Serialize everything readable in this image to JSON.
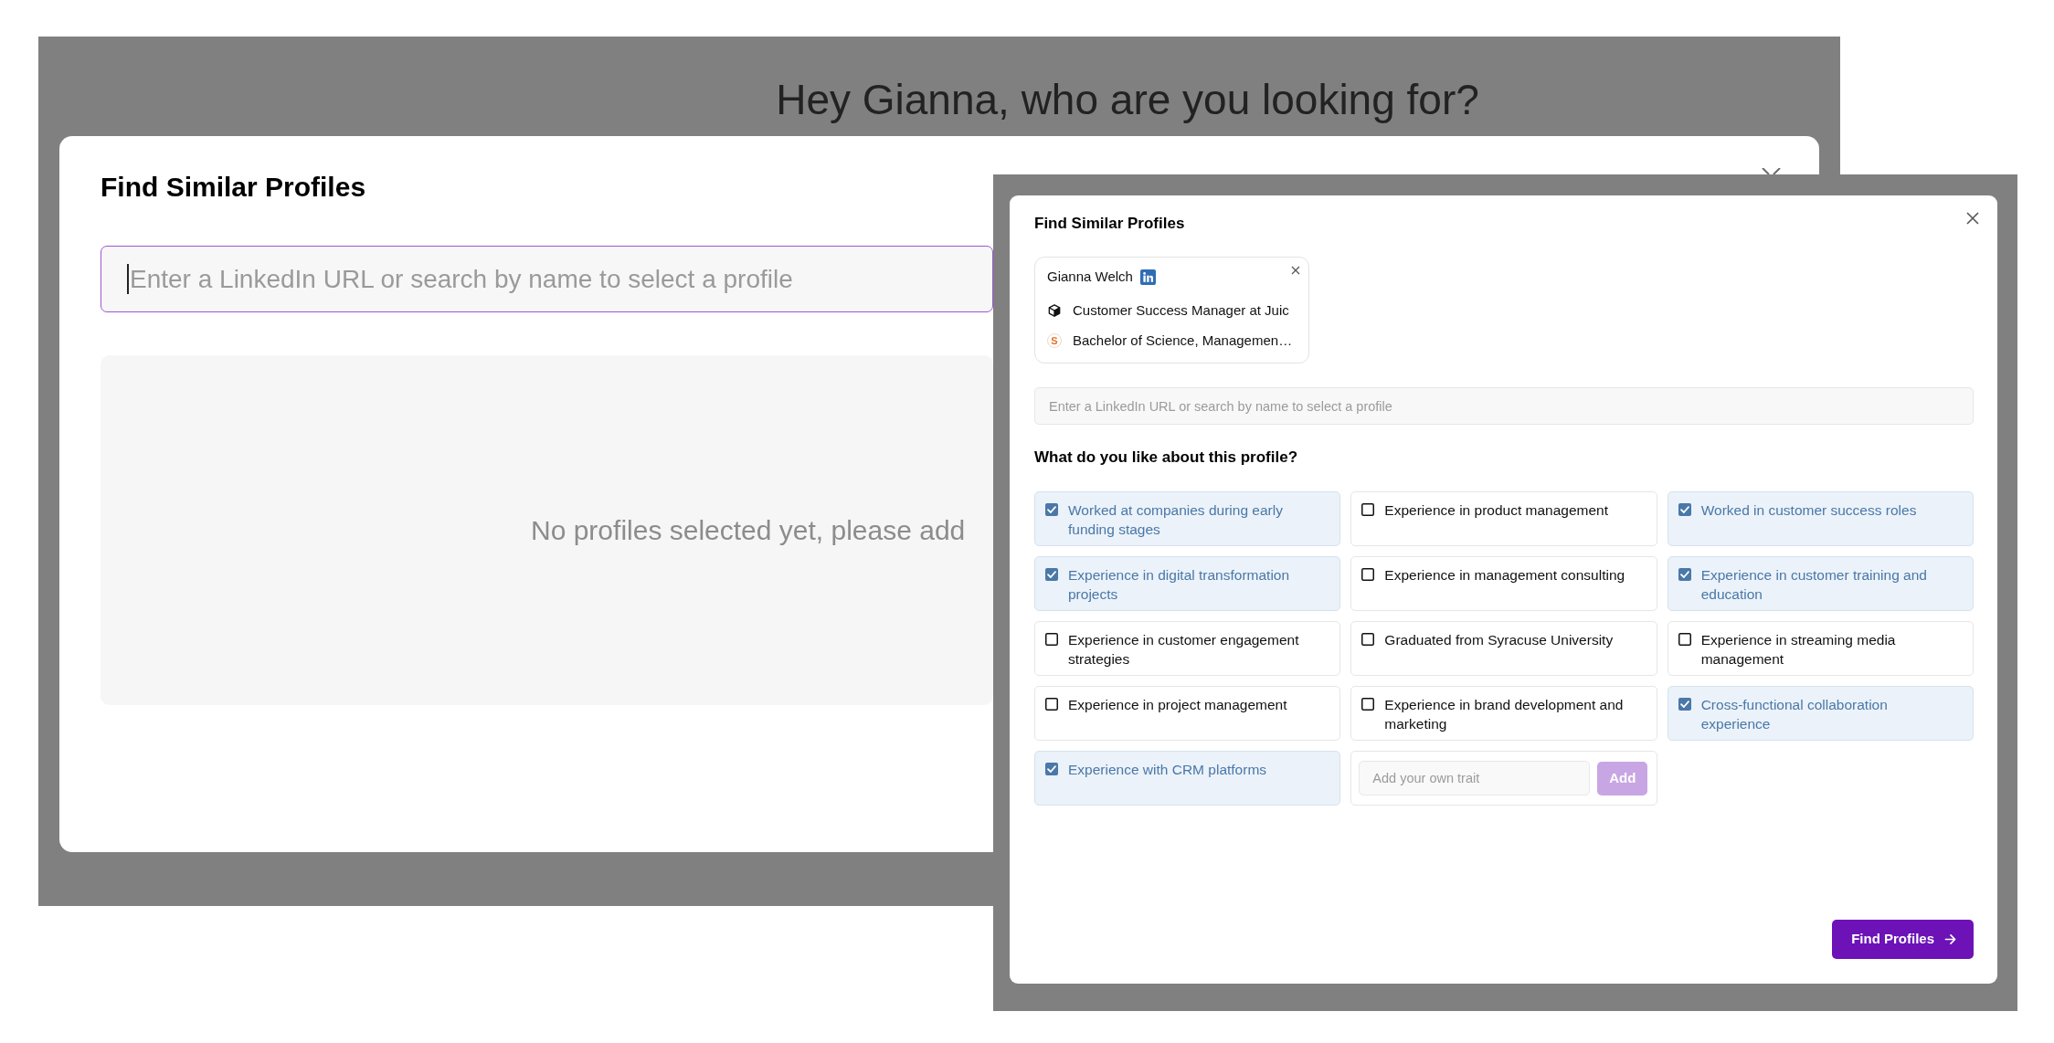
{
  "background_window": {
    "greeting": "Hey Gianna, who are you looking for?",
    "modal": {
      "title": "Find Similar Profiles",
      "search": {
        "placeholder": "Enter a LinkedIn URL or search by name to select a profile",
        "focused": true
      },
      "empty_message": "No profiles selected yet, please add"
    }
  },
  "foreground_window": {
    "modal": {
      "title": "Find Similar Profiles",
      "selected_profile": {
        "name": "Gianna Welch",
        "details": [
          {
            "kind": "work",
            "text": "Customer Success Manager at Juic"
          },
          {
            "kind": "education",
            "logo": "S",
            "text": "Bachelor of Science, Managemen…"
          }
        ]
      },
      "search": {
        "placeholder": "Enter a LinkedIn URL or search by name to select a profile"
      },
      "traits_heading": "What do you like about this profile?",
      "traits": [
        {
          "label": "Worked at companies during early funding stages",
          "checked": true
        },
        {
          "label": "Experience in product management",
          "checked": false
        },
        {
          "label": "Worked in customer success roles",
          "checked": true
        },
        {
          "label": "Experience in digital transformation projects",
          "checked": true
        },
        {
          "label": "Experience in management consulting",
          "checked": false
        },
        {
          "label": "Experience in customer training and education",
          "checked": true
        },
        {
          "label": "Experience in customer engagement strategies",
          "checked": false
        },
        {
          "label": "Graduated from Syracuse University",
          "checked": false
        },
        {
          "label": "Experience in streaming media management",
          "checked": false
        },
        {
          "label": "Experience in project management",
          "checked": false
        },
        {
          "label": "Experience in brand development and marketing",
          "checked": false
        },
        {
          "label": "Cross-functional collaboration experience",
          "checked": true
        },
        {
          "label": "Experience with CRM platforms",
          "checked": true
        }
      ],
      "custom_trait": {
        "placeholder": "Add your own trait",
        "add_button": {
          "label": "Add",
          "disabled": true
        }
      },
      "submit_button": "Find Profiles"
    }
  }
}
